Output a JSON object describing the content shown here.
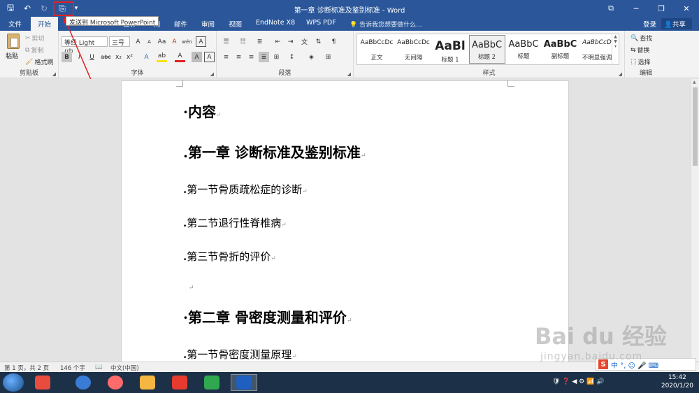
{
  "window": {
    "title": "第一章 诊断标准及鉴别标准 - Word",
    "controls": [
      "⧉",
      "─",
      "❐",
      "✕"
    ]
  },
  "qat": {
    "save_glyph": "🖫",
    "undo_glyph": "↶",
    "redo_glyph": "↻",
    "ppt_glyph": "⎘",
    "more_glyph": "▾",
    "tooltip": "发送到 Microsoft PowerPoint"
  },
  "tabs": [
    {
      "label": "文件",
      "active": false
    },
    {
      "label": "开始",
      "active": true
    },
    {
      "label": "设计",
      "active": false
    },
    {
      "label": "用",
      "active": false
    },
    {
      "label": "邮件",
      "active": false
    },
    {
      "label": "审阅",
      "active": false
    },
    {
      "label": "视图",
      "active": false
    },
    {
      "label": "EndNote X8",
      "active": false
    },
    {
      "label": "WPS PDF",
      "active": false
    }
  ],
  "tell_me": "告诉我您想要做什么...",
  "sign_in": "登录",
  "share": "共享",
  "clipboard": {
    "label": "剪贴板",
    "paste": "粘贴",
    "cut": "剪切",
    "copy": "复制",
    "format_painter": "格式刷"
  },
  "font": {
    "label": "字体",
    "font_name": "等线 Light (中",
    "font_size": "三号",
    "grow": "A",
    "shrink": "A",
    "aa": "Aa",
    "clear": "A",
    "wen": "wén",
    "a_box": "A",
    "bold": "B",
    "italic": "I",
    "underline": "U",
    "strike": "abc",
    "sub": "x₂",
    "sup": "x²",
    "effects": "A",
    "highlight": "ab",
    "color": "A",
    "char_shade": "A",
    "char_border": "A"
  },
  "paragraph": {
    "label": "段落"
  },
  "styles": {
    "label": "样式",
    "items": [
      {
        "preview": "AaBbCcDc",
        "name": "正文",
        "size": "9px",
        "bold": false,
        "selected": false
      },
      {
        "preview": "AaBbCcDc",
        "name": "无间隔",
        "size": "9px",
        "bold": false,
        "selected": false
      },
      {
        "preview": "AaBl",
        "name": "标题 1",
        "size": "17px",
        "bold": true,
        "selected": false
      },
      {
        "preview": "AaBbC",
        "name": "标题 2",
        "size": "13px",
        "bold": false,
        "selected": true
      },
      {
        "preview": "AaBbC",
        "name": "标题",
        "size": "13px",
        "bold": false,
        "selected": false
      },
      {
        "preview": "AaBbC",
        "name": "副标题",
        "size": "13px",
        "bold": true,
        "selected": false
      },
      {
        "preview": "AaBbCcD",
        "name": "不明显强调",
        "size": "9px",
        "bold": false,
        "selected": false
      }
    ]
  },
  "editing": {
    "label": "编辑",
    "find": "查找",
    "replace": "替换",
    "select": "选择"
  },
  "document": {
    "lines": [
      {
        "bullet": "·",
        "text": "内容",
        "style": "h1"
      },
      {
        "bullet": ".",
        "text": "第一章  诊断标准及鉴别标准",
        "style": "h1"
      },
      {
        "bullet": ".",
        "text": "第一节骨质疏松症的诊断",
        "style": "h2"
      },
      {
        "bullet": ".",
        "text": "第二节退行性脊椎病",
        "style": "h2"
      },
      {
        "bullet": ".",
        "text": "第三节骨折的评价",
        "style": "h2"
      },
      {
        "bullet": "",
        "text": "",
        "style": "h2"
      },
      {
        "bullet": "·",
        "text": "第二章  骨密度测量和评价",
        "style": "h1"
      },
      {
        "bullet": ".",
        "text": "第一节骨密度测量原理",
        "style": "h2"
      }
    ],
    "para_mark": "↵"
  },
  "status": {
    "page": "第 1 页，共 2 页",
    "words": "146 个字",
    "lang": "中文(中国)"
  },
  "taskbar": {
    "time": "15:42",
    "date": "2020/1/20",
    "app_colors": [
      "#3a7bd5",
      "#ff6b6b",
      "#f5b642",
      "#e74c3c",
      "#e63b2e",
      "#1e5fbf"
    ],
    "tray_icons": "🛡 ❓ ◀ ⚙ 📶 🔊"
  },
  "ime": {
    "s": "S",
    "items": "中 °, ☺ 🎤 ⌨"
  },
  "watermark": {
    "big": "Bai du 经验",
    "small": "jingyan.baidu.com"
  }
}
